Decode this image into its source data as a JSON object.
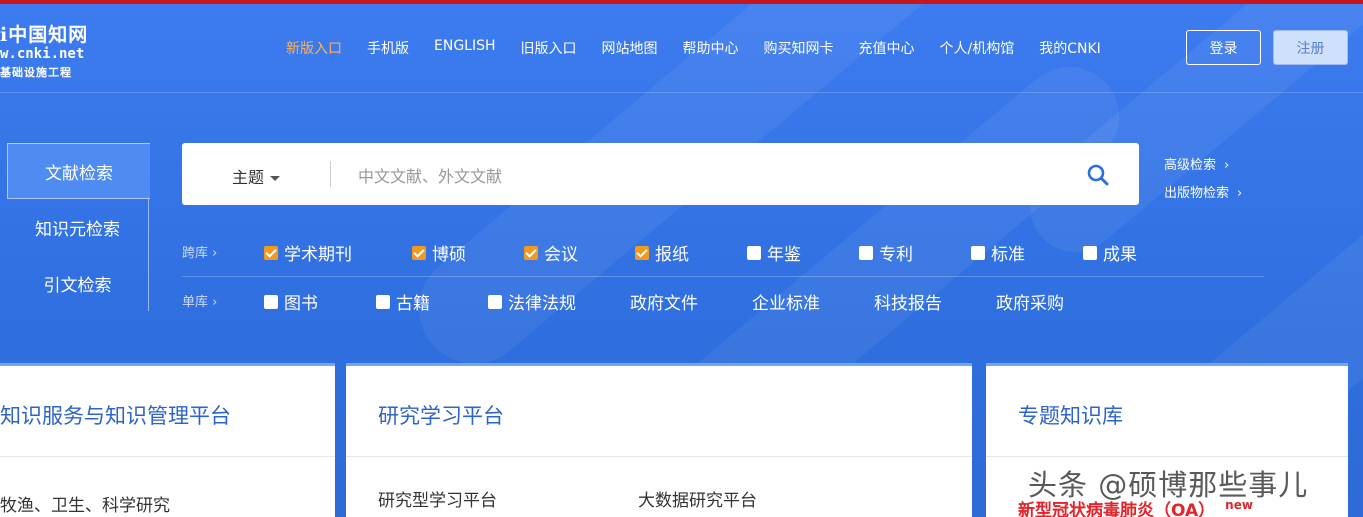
{
  "logo": {
    "line1": "i中国知网",
    "line2": "w.cnki.net",
    "line3": "基础设施工程"
  },
  "nav": [
    {
      "label": "新版入口",
      "active": true
    },
    {
      "label": "手机版"
    },
    {
      "label": "ENGLISH"
    },
    {
      "label": "旧版入口"
    },
    {
      "label": "网站地图"
    },
    {
      "label": "帮助中心"
    },
    {
      "label": "购买知网卡"
    },
    {
      "label": "充值中心"
    },
    {
      "label": "个人/机构馆"
    },
    {
      "label": "我的CNKI"
    }
  ],
  "auth": {
    "login": "登录",
    "register": "注册"
  },
  "side_tabs": [
    "文献检索",
    "知识元检索",
    "引文检索"
  ],
  "search": {
    "field": "主题",
    "placeholder": "中文文献、外文文献"
  },
  "advanced": {
    "advanced_search": "高级检索",
    "publication_search": "出版物检索",
    "arrow": "›"
  },
  "cross_db": {
    "label": "跨库",
    "arrow": "›",
    "items": [
      {
        "label": "学术期刊",
        "checked": true
      },
      {
        "label": "博硕",
        "checked": true
      },
      {
        "label": "会议",
        "checked": true
      },
      {
        "label": "报纸",
        "checked": true
      },
      {
        "label": "年鉴",
        "checked": false
      },
      {
        "label": "专利",
        "checked": false
      },
      {
        "label": "标准",
        "checked": false
      },
      {
        "label": "成果",
        "checked": false
      }
    ]
  },
  "single_db": {
    "label": "单库",
    "arrow": "›",
    "checks": [
      {
        "label": "图书",
        "checked": false
      },
      {
        "label": "古籍",
        "checked": false
      },
      {
        "label": "法律法规",
        "checked": false
      }
    ],
    "links": [
      "政府文件",
      "企业标准",
      "科技报告",
      "政府采购"
    ]
  },
  "cards": {
    "knowledge": {
      "title": "知识服务与知识管理平台",
      "item": "牧渔、卫生、科学研究"
    },
    "research": {
      "title": "研究学习平台",
      "items": [
        "研究型学习平台",
        "大数据研究平台"
      ]
    },
    "topics": {
      "title": "专题知识库",
      "hot": "新型冠状病毒肺炎（OA）",
      "badge": "new"
    }
  },
  "watermark": "头条 @硕博那些事儿",
  "colors": {
    "accent": "#ffb057",
    "checked": "#f39a1e",
    "brand_blue": "#2f6fde",
    "alert_red": "#e0262b"
  }
}
